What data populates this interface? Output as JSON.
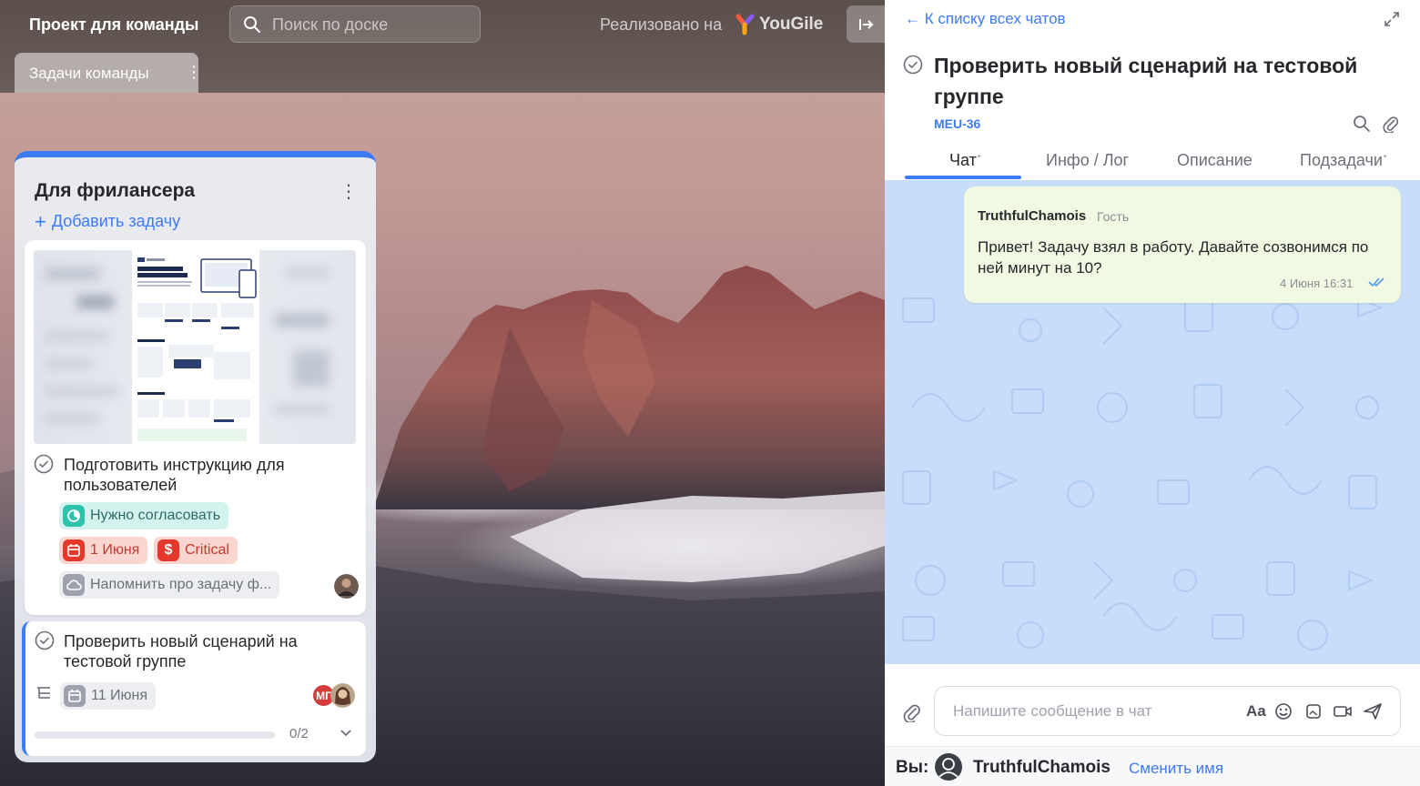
{
  "topbar": {
    "project_title": "Проект для команды",
    "search_placeholder": "Поиск по доске",
    "powered_by": "Реализовано на",
    "brand": "YouGile",
    "collapse_icon": "arrow-to-right-icon"
  },
  "board_tab": {
    "label": "Задачи команды"
  },
  "column": {
    "title": "Для фрилансера",
    "add_task": "Добавить задачу",
    "accent": "#3d7bf5"
  },
  "card1": {
    "title_line1": "Подготовить инструкцию для",
    "title_line2": "пользователей",
    "sticker_status": "Нужно согласовать",
    "sticker_date": "1 Июня",
    "sticker_priority": "Critical",
    "reminder": "Напомнить про задачу ф..."
  },
  "card2": {
    "title_line1": "Проверить новый сценарий на",
    "title_line2": "тестовой группе",
    "date": "11 Июня",
    "avatar_initials": "МГ",
    "subtasks_done": 0,
    "subtasks_total": 2,
    "subtasks_count": "0/2"
  },
  "chat": {
    "back_link": "К списку всех чатов",
    "title": "Проверить новый сценарий на тестовой группе",
    "task_id": "MEU-36",
    "tabs": [
      {
        "label": "Чат",
        "active": true,
        "dot": "•"
      },
      {
        "label": "Инфо / Лог",
        "active": false,
        "dot": ""
      },
      {
        "label": "Описание",
        "active": false,
        "dot": ""
      },
      {
        "label": "Подзадачи",
        "active": false,
        "dot": "•"
      }
    ],
    "message": {
      "author": "TruthfulChamois",
      "role": "Гость",
      "text": "Привет! Задачу взял в работу. Давайте созвонимся по ней минут на 10?",
      "time": "4 Июня 16:31"
    },
    "composer_placeholder": "Напишите сообщение в чат",
    "format_label": "Aa",
    "identity_label": "Вы:",
    "identity_name": "TruthfulChamois",
    "change_name": "Сменить имя"
  }
}
